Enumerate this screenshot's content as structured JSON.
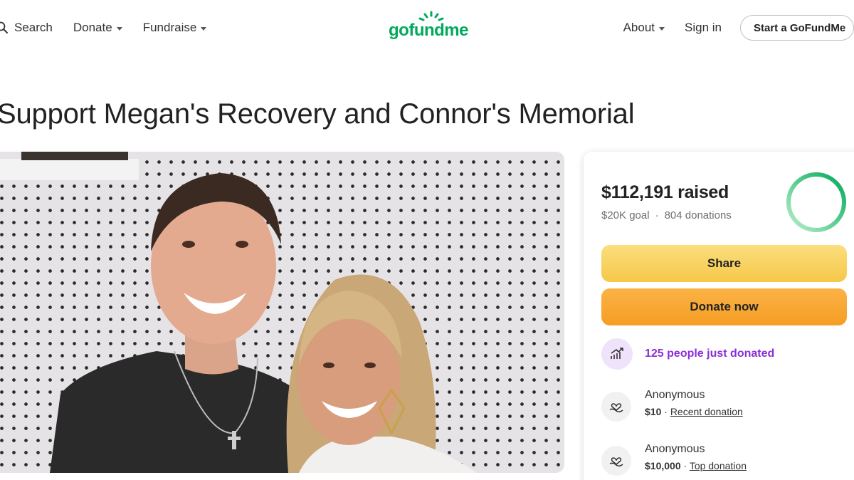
{
  "header": {
    "search_label": "Search",
    "donate_label": "Donate",
    "fundraise_label": "Fundraise",
    "logo_text": "gofundme",
    "about_label": "About",
    "signin_label": "Sign in",
    "start_label": "Start a GoFundMe"
  },
  "campaign": {
    "title": "Support Megan's Recovery and Connor's Memorial"
  },
  "donation": {
    "raised": "$112,191 raised",
    "goal": "$20K goal",
    "goal_separator": "·",
    "donations_count": "804 donations",
    "progress_fraction": 1.0,
    "share_label": "Share",
    "donate_label": "Donate now",
    "trend_text": "125 people just donated",
    "donors": [
      {
        "name": "Anonymous",
        "amount": "$10",
        "separator": " · ",
        "tag": "Recent donation"
      },
      {
        "name": "Anonymous",
        "amount": "$10,000",
        "separator": " · ",
        "tag": "Top donation"
      }
    ]
  },
  "colors": {
    "brand_green": "#02a95c",
    "share_yellow": "#f6c84a",
    "donate_orange": "#f59d24",
    "trend_purple": "#8a2fd6"
  },
  "icons": [
    "search-icon",
    "caret-down-icon",
    "trending-up-icon",
    "heart-hand-icon"
  ]
}
